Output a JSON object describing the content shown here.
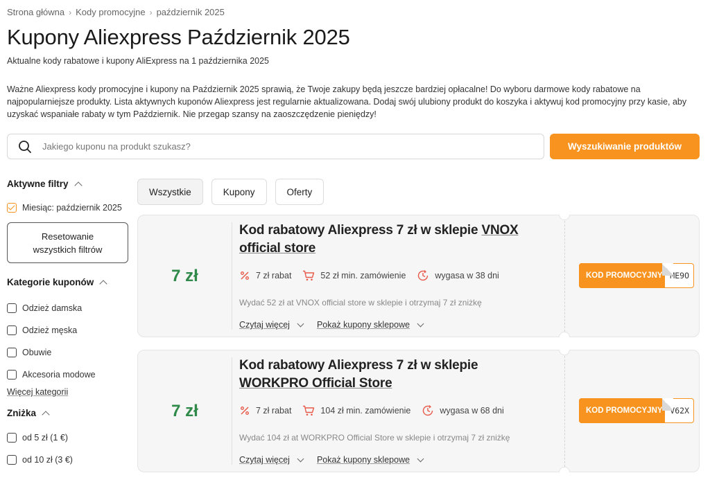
{
  "breadcrumb": [
    "Strona główna",
    "Kody promocyjne",
    "październik 2025"
  ],
  "title": "Kupony Aliexpress Październik 2025",
  "subtitle": "Aktualne kody rabatowe i kupony AliExpress na 1 października 2025",
  "intro": "Ważne Aliexpress kody promocyjne i kupony na Październik 2025 sprawią, że Twoje zakupy będą jeszcze bardziej opłacalne! Do wyboru darmowe kody rabatowe na najpopularniejsze produkty. Lista aktywnych kuponów Aliexpress jest regularnie aktualizowana. Dodaj swój ulubiony produkt do koszyka i aktywuj kod promocyjny przy kasie, aby uzyskać wspaniałe rabaty w tym Październik. Nie przegap szansy na zaoszczędzenie pieniędzy!",
  "search": {
    "placeholder": "Jakiego kuponu na produkt szukasz?",
    "button": "Wyszukiwanie produktów"
  },
  "sidebar": {
    "active_filters": {
      "heading": "Aktywne filtry",
      "items": [
        "Miesiąc: październik 2025"
      ],
      "reset_label": "Resetowanie wszystkich filtrów"
    },
    "categories": {
      "heading": "Kategorie kuponów",
      "items": [
        "Odzież damska",
        "Odzież męska",
        "Obuwie",
        "Akcesoria modowe"
      ],
      "more": "Więcej kategorii"
    },
    "discount": {
      "heading": "Zniżka",
      "items": [
        "od 5 zł (1 €)",
        "od 10 zł (3 €)"
      ]
    }
  },
  "tabs": [
    "Wszystkie",
    "Kupony",
    "Oferty"
  ],
  "coupons": [
    {
      "amount": "7 zł",
      "title_prefix": "Kod rabatowy Aliexpress 7 zł w sklepie",
      "store": "VNOX official store",
      "rabat": "7 zł rabat",
      "min_order": "52 zł min. zamówienie",
      "expires": "wygasa w 38 dni",
      "description": "Wydać 52 zł at VNOX official store w sklepie i otrzymaj 7 zł zniżkę",
      "read_more": "Czytaj więcej",
      "show_store": "Pokaż kupony sklepowe",
      "promo_label": "KOD PROMOCYJNY",
      "code_tail": "ME9O"
    },
    {
      "amount": "7 zł",
      "title_prefix": "Kod rabatowy Aliexpress 7 zł w sklepie",
      "store": "WORKPRO Official Store",
      "rabat": "7 zł rabat",
      "min_order": "104 zł min. zamówienie",
      "expires": "wygasa w 68 dni",
      "description": "Wydać 104 zł at WORKPRO Official Store w sklepie i otrzymaj 7 zł zniżkę",
      "read_more": "Czytaj więcej",
      "show_store": "Pokaż kupony sklepowe",
      "promo_label": "KOD PROMOCYJNY",
      "code_tail": "V62X"
    }
  ],
  "colors": {
    "accent": "#f7931e",
    "amount_green": "#2f8a4a"
  }
}
